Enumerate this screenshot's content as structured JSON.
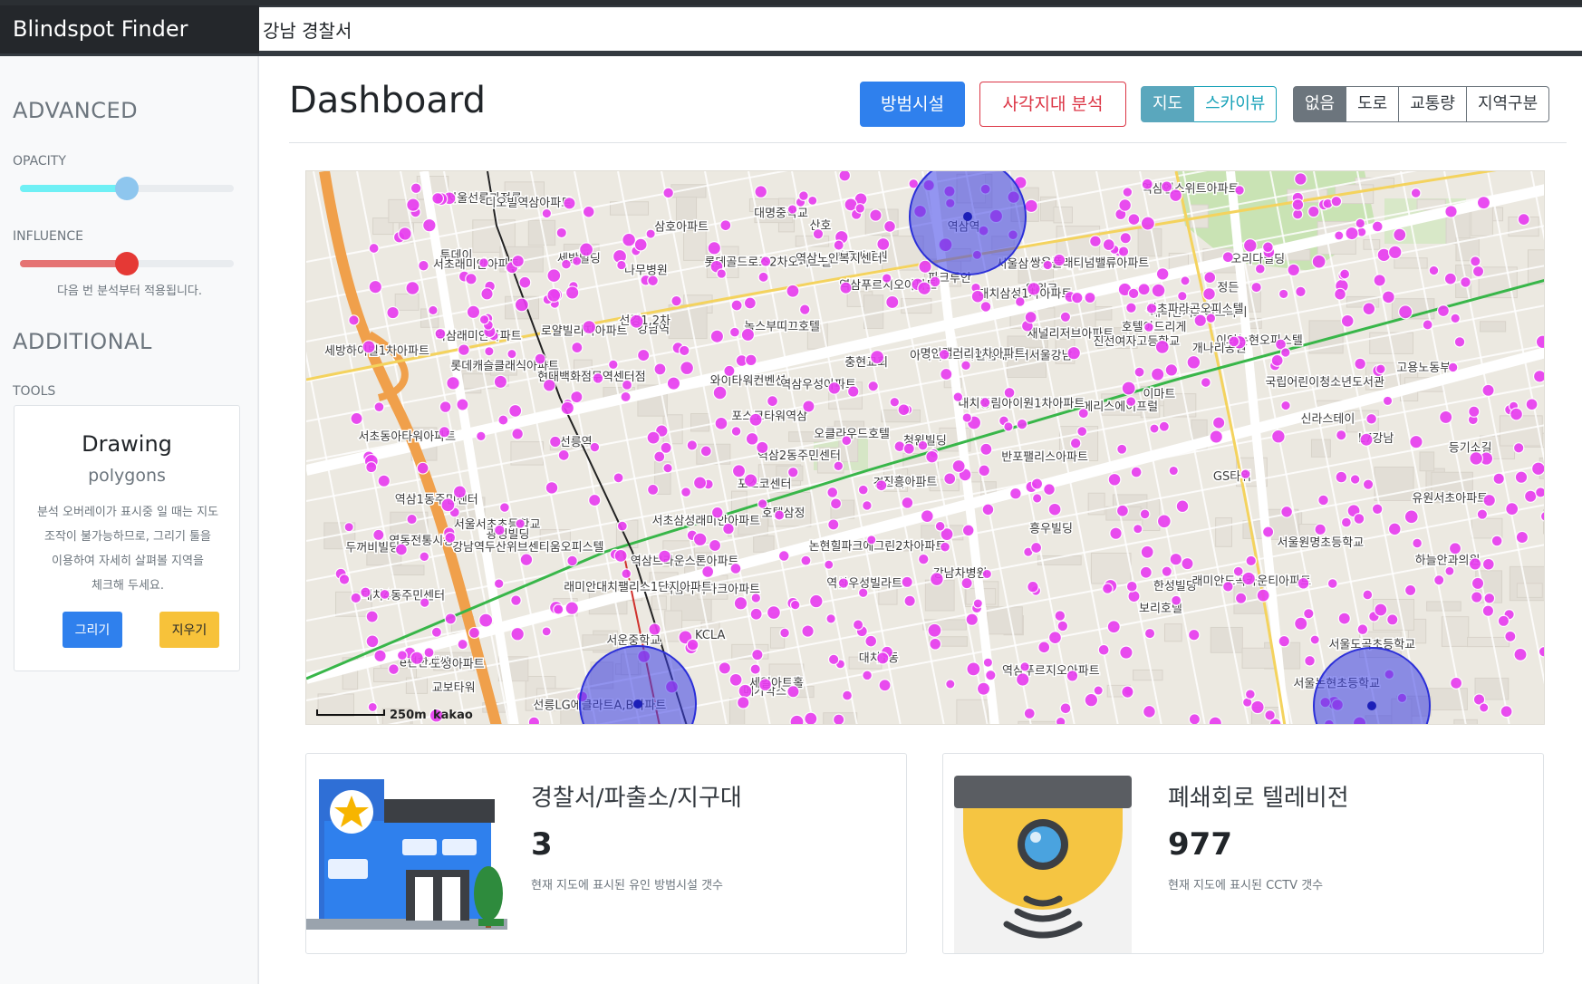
{
  "app": {
    "brand": "Blindspot Finder"
  },
  "search": {
    "value": "강남 경찰서"
  },
  "sidebar": {
    "advanced_heading": "ADVANCED",
    "opacity_label": "OPACITY",
    "opacity_value": 0.5,
    "influence_label": "INFLUENCE",
    "influence_value": 0.5,
    "influence_note": "다음 번 분석부터 적용됩니다.",
    "additional_heading": "ADDITIONAL",
    "tools_label": "TOOLS",
    "tool_card": {
      "title": "Drawing",
      "subtitle": "polygons",
      "description": "분석 오버레이가 표시중 일 때는 지도 조작이 불가능하므로, 그리기 툴을 이용하여 자세히 살펴볼 지역을 체크해 두세요.",
      "draw_label": "그리기",
      "erase_label": "지우기"
    }
  },
  "header": {
    "title": "Dashboard",
    "facilities_label": "방범시설",
    "blindspot_label": "사각지대 분석",
    "view_modes": [
      "지도",
      "스카이뷰"
    ],
    "active_view_mode": "지도",
    "overlays": [
      "없음",
      "도로",
      "교통량",
      "지역구분"
    ],
    "active_overlay": "없음"
  },
  "map": {
    "scale_label": "250m",
    "attribution": "kakao",
    "labels": [
      "영동전통시장",
      "언주비공원",
      "하늘안과의원",
      "서울논현초등학교",
      "논현힐파크에그린2차아파트",
      "e편한세상",
      "나무병원",
      "투데이",
      "이안논현오피스텔",
      "서울삼성동우체국",
      "등기소길",
      "서울선릉과정릉",
      "채널리저브아파트",
      "현대백화점무역센터점",
      "반포팰리스아파트",
      "강남차병원",
      "역삼엔스위트아파트",
      "KCLA",
      "선릉LG에클라트A,B아파트",
      "포스코센터",
      "대명중학교",
      "산호",
      "교보타워",
      "호텔삼정",
      "와이타워컨벤션",
      "충현교회",
      "역삼푸르지오아파트",
      "신라스테이",
      "선릉역",
      "L7강남",
      "아이비스스타일앰배서더서울강남",
      "래미안서초에스티지",
      "메리스에이프럴",
      "정든",
      "오클라우드호텔",
      "역삼우성아파트",
      "로얄빌리지아파트",
      "GS타워",
      "녹스부띠끄호텔",
      "디오빌역삼아파트",
      "두꺼비빌딩",
      "세방빌딩",
      "롯데골드로즈2차오피스텔",
      "진선여자고등학교",
      "대치풍림아이원1차아파트",
      "도성아파트",
      "서울원명초등학교",
      "롯데캐슬클래식아파트",
      "국립어린이청소년도서관",
      "한성빌딩",
      "포스코타워역삼",
      "역삼역",
      "호텔아드리게",
      "경남아파트",
      "역삼아이파크아파트",
      "이마트",
      "서울도곡초등학교",
      "대치4동주민센터",
      "서초래미안아파트",
      "서울서초초등학교",
      "강남역",
      "메가박스",
      "강남역두산위브센티움오피스텔",
      "파크루안",
      "명인갤러리1차아파트",
      "역삼푸르지오아파트",
      "역삼래미안아파트",
      "오리다빌딩",
      "진흥아파트",
      "청원빌딩",
      "개나리공원",
      "세일아트홀",
      "세방하이빌1차아파트",
      "유원서초아파트",
      "서초동아타워아파트",
      "위워크",
      "쌍용플래티넘밸류아파트",
      "역삼브라운스톤아파트",
      "역삼2동주민센터",
      "래미안도곡카운티아파트",
      "고용노동부",
      "대치삼성1차아파트",
      "역삼1동주민센터",
      "보리호텔",
      "역삼우성빌라트",
      "역삼노인복지센터",
      "서초파라곤오피스텔",
      "광성빌딩",
      "서초삼성래미안아파트",
      "서운중학교",
      "흥우빌딩",
      "삼호아파트",
      "래미안대치팰리스1단지아파트",
      "대치1동",
      "선경1,2차"
    ]
  },
  "stats": [
    {
      "title": "경찰서/파출소/지구대",
      "value": "3",
      "description": "현재 지도에 표시된 유인 방범시설 갯수",
      "icon": "police-station-icon"
    },
    {
      "title": "폐쇄회로 텔레비전",
      "value": "977",
      "description": "현재 지도에 표시된 CCTV 갯수",
      "icon": "cctv-camera-icon"
    }
  ],
  "colors": {
    "cctv_marker": "#e83ef0",
    "police_zone": "#3a3ee6",
    "opacity_slider": "#6ff0f5",
    "influence_slider": "#e57373",
    "primary": "#2f80ed",
    "danger": "#dc3545",
    "warning": "#f7c23a"
  }
}
